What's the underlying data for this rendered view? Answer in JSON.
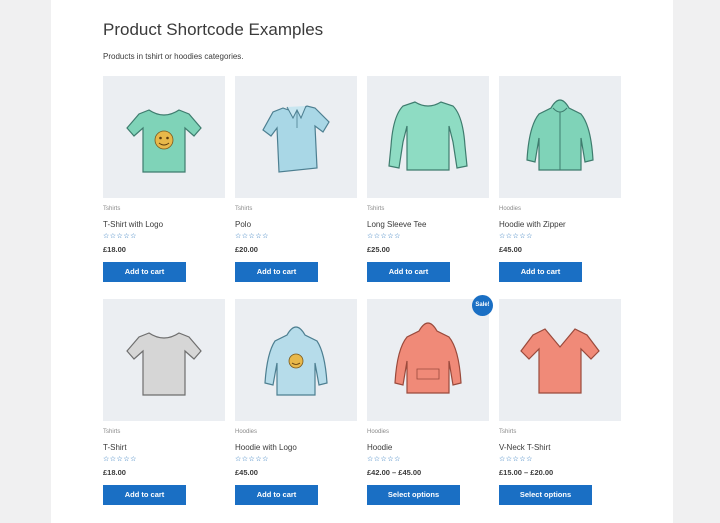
{
  "page": {
    "title": "Product Shortcode Examples",
    "subtitle": "Products in tshirt or hoodies categories."
  },
  "colors": {
    "button": "#1a6fc4",
    "thumb_bg": "#ebeef2",
    "page_bg": "#f0f0f1"
  },
  "products": [
    {
      "category": "Tshirts",
      "name": "T-Shirt with Logo",
      "rating": "☆☆☆☆☆",
      "price": "£18.00",
      "button": "Add to cart",
      "image": "mint-tshirt-logo"
    },
    {
      "category": "Tshirts",
      "name": "Polo",
      "rating": "☆☆☆☆☆",
      "price": "£20.00",
      "button": "Add to cart",
      "image": "blue-polo"
    },
    {
      "category": "Tshirts",
      "name": "Long Sleeve Tee",
      "rating": "☆☆☆☆☆",
      "price": "£25.00",
      "button": "Add to cart",
      "image": "mint-long-sleeve"
    },
    {
      "category": "Hoodies",
      "name": "Hoodie with Zipper",
      "rating": "☆☆☆☆☆",
      "price": "£45.00",
      "button": "Add to cart",
      "image": "mint-zip-hoodie"
    },
    {
      "category": "Tshirts",
      "name": "T-Shirt",
      "rating": "☆☆☆☆☆",
      "price": "£18.00",
      "button": "Add to cart",
      "image": "grey-tshirt"
    },
    {
      "category": "Hoodies",
      "name": "Hoodie with Logo",
      "rating": "☆☆☆☆☆",
      "price": "£45.00",
      "button": "Add to cart",
      "image": "blue-hoodie-logo"
    },
    {
      "category": "Hoodies",
      "name": "Hoodie",
      "rating": "☆☆☆☆☆",
      "price": "£42.00 – £45.00",
      "button": "Select options",
      "image": "coral-hoodie",
      "badge": "Sale!"
    },
    {
      "category": "Tshirts",
      "name": "V-Neck T-Shirt",
      "rating": "☆☆☆☆☆",
      "price": "£15.00 – £20.00",
      "button": "Select options",
      "image": "coral-vneck"
    }
  ]
}
